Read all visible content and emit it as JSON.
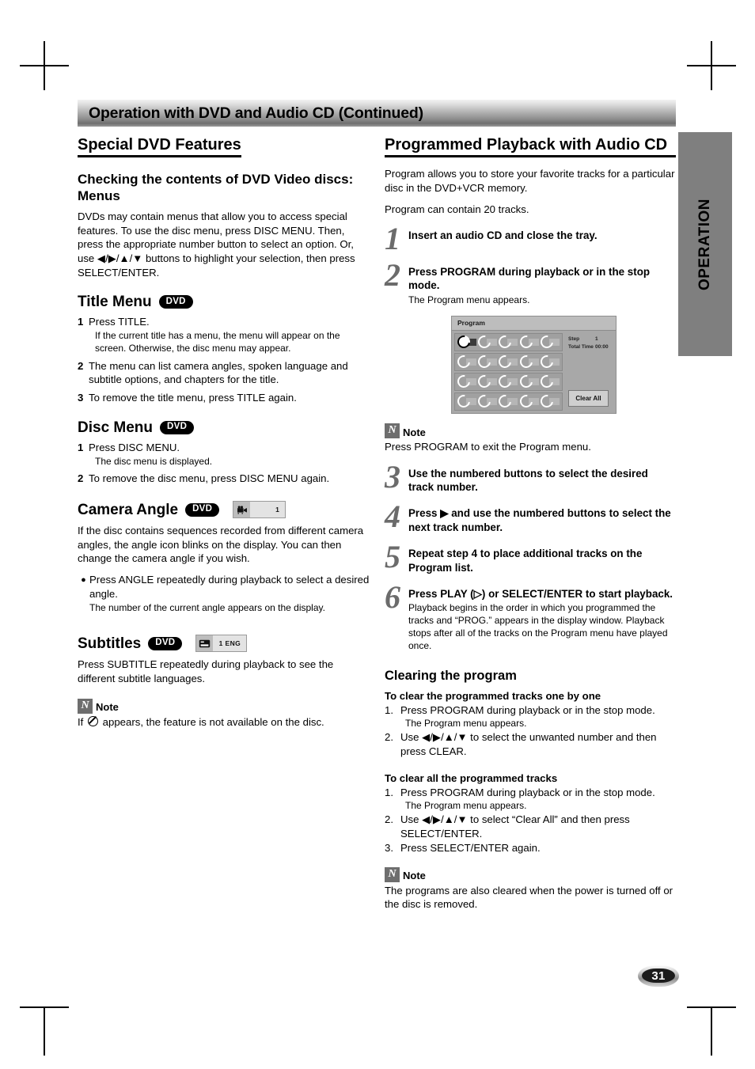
{
  "header": {
    "title": "Operation with DVD and Audio CD (Continued)"
  },
  "side_tab": {
    "label": "OPERATION"
  },
  "page_number": "31",
  "badges": {
    "dvd": "DVD"
  },
  "left": {
    "section_title": "Special DVD Features",
    "checking": {
      "heading": "Checking the contents of DVD Video discs: Menus",
      "body": "DVDs may contain menus that allow you to access special features. To use the disc menu, press DISC MENU. Then, press the appropriate number button to select an option. Or, use ◀/▶/▲/▼ buttons to highlight your selection, then press SELECT/ENTER."
    },
    "title_menu": {
      "heading": "Title Menu",
      "steps": [
        {
          "n": "1",
          "text": "Press TITLE.",
          "note": "If the current title has a menu, the menu will appear on the screen. Otherwise, the disc menu may appear."
        },
        {
          "n": "2",
          "text": "The menu can list camera angles, spoken language and subtitle options, and chapters for the title.",
          "note": ""
        },
        {
          "n": "3",
          "text": "To remove the title menu, press TITLE again.",
          "note": ""
        }
      ]
    },
    "disc_menu": {
      "heading": "Disc Menu",
      "steps": [
        {
          "n": "1",
          "text": "Press DISC MENU.",
          "note": "The disc menu is displayed."
        },
        {
          "n": "2",
          "text": "To remove the disc menu, press DISC MENU again.",
          "note": ""
        }
      ]
    },
    "camera_angle": {
      "heading": "Camera Angle",
      "chip_value": "1",
      "body": "If the disc contains sequences recorded from different camera angles, the angle icon blinks on the display. You can then change the camera angle if you wish.",
      "bullet": "Press ANGLE repeatedly during playback to select a desired angle.",
      "bullet_note": "The number of the current angle appears on the display."
    },
    "subtitles": {
      "heading": "Subtitles",
      "chip_value": "1  ENG",
      "body": "Press SUBTITLE repeatedly during playback to see the different subtitle languages."
    },
    "note": {
      "label": "Note",
      "badge": "N",
      "text_before": "If",
      "text_after": "appears, the feature is not available on the disc."
    }
  },
  "right": {
    "section_title": "Programmed Playback with Audio CD",
    "intro1": "Program allows you to store your favorite tracks for a particular disc in the DVD+VCR memory.",
    "intro2": "Program can contain 20 tracks.",
    "steps_top": [
      {
        "n": "1",
        "lead": "Insert an audio CD and close the tray.",
        "sub": ""
      },
      {
        "n": "2",
        "lead": "Press PROGRAM during playback or in the stop mode.",
        "sub": "The Program menu appears."
      }
    ],
    "program_menu": {
      "title": "Program",
      "step_label": "Step",
      "step_value": "1",
      "total_time_label": "Total Time",
      "total_time_value": "00:00",
      "clear_all_label": "Clear All",
      "rows": 4,
      "cols": 5,
      "selected_index": 0
    },
    "note1": {
      "badge": "N",
      "label": "Note",
      "text": "Press PROGRAM to exit the Program menu."
    },
    "steps_bottom": [
      {
        "n": "3",
        "lead": "Use the numbered buttons to select the desired track number.",
        "sub": ""
      },
      {
        "n": "4",
        "lead": "Press ▶ and use the numbered buttons to select the next track number.",
        "sub": ""
      },
      {
        "n": "5",
        "lead": "Repeat step 4 to place additional tracks on the Program list.",
        "sub": ""
      },
      {
        "n": "6",
        "lead": "Press PLAY (▷) or SELECT/ENTER to start playback.",
        "sub": "Playback begins in the order in which you programmed the tracks and “PROG.” appears in the display window. Playback stops after all of the tracks on the Program menu have played once."
      }
    ],
    "clearing": {
      "heading": "Clearing the program",
      "group1_heading": "To clear the programmed tracks one by one",
      "group1_items": [
        {
          "n": "1.",
          "text": "Press PROGRAM during playback or in the stop mode.",
          "note": "The Program menu appears."
        },
        {
          "n": "2.",
          "text": "Use ◀/▶/▲/▼ to select the unwanted number and then press CLEAR.",
          "note": ""
        }
      ],
      "group2_heading": "To clear all the programmed tracks",
      "group2_items": [
        {
          "n": "1.",
          "text": "Press PROGRAM during playback or in the stop mode.",
          "note": "The Program menu appears."
        },
        {
          "n": "2.",
          "text": "Use ◀/▶/▲/▼ to select “Clear All” and then press SELECT/ENTER.",
          "note": ""
        },
        {
          "n": "3.",
          "text": "Press SELECT/ENTER again.",
          "note": ""
        }
      ]
    },
    "note2": {
      "badge": "N",
      "label": "Note",
      "text": "The programs are also cleared when the power is turned off or the disc is removed."
    }
  }
}
